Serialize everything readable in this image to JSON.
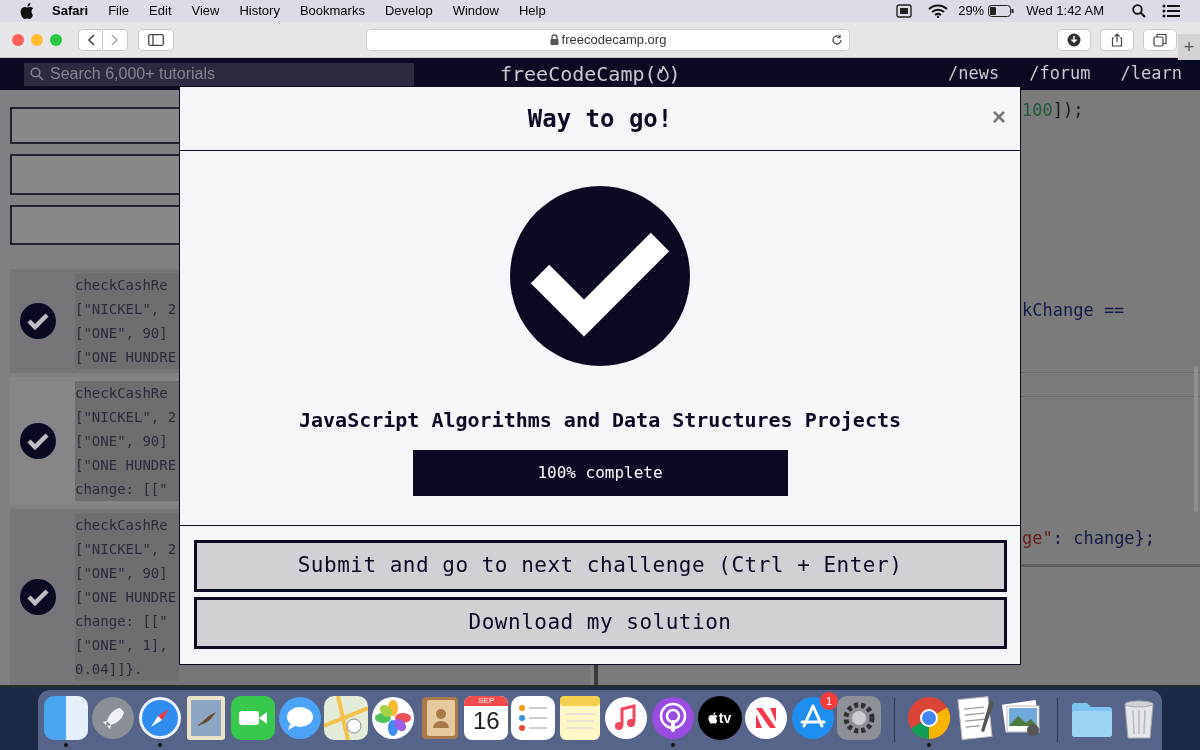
{
  "menu_bar": {
    "app_name": "Safari",
    "menus": [
      "File",
      "Edit",
      "View",
      "History",
      "Bookmarks",
      "Develop",
      "Window",
      "Help"
    ],
    "battery": "29%",
    "clock": "Wed 1:42 AM"
  },
  "browser": {
    "url": "freecodecamp.org",
    "new_tab": "+"
  },
  "site_nav": {
    "search_placeholder": "Search 6,000+ tutorials",
    "logo": "freeCodeCamp",
    "logo_open": "(",
    "logo_close": ")",
    "links": [
      "/news",
      "/forum",
      "/learn"
    ]
  },
  "tests": [
    {
      "passed": true,
      "lines": [
        "checkCashRe",
        "[\"NICKEL\", 2",
        "[\"ONE\", 90]",
        "[\"ONE HUNDRE"
      ]
    },
    {
      "passed": true,
      "lines": [
        "checkCashRe",
        "[\"NICKEL\", 2",
        "[\"ONE\", 90]",
        "[\"ONE HUNDRE",
        "change: [[\""
      ]
    },
    {
      "passed": true,
      "lines": [
        "checkCashRe",
        "[\"NICKEL\", 2",
        "[\"ONE\", 90]",
        "[\"ONE HUNDRE",
        "change: [[\"",
        "[\"ONE\", 1],",
        "0.04]]}."
      ]
    }
  ],
  "editor": {
    "lines": [
      {
        "parts": [
          {
            "text": "100",
            "kind": "number"
          },
          {
            "text": "]);",
            "kind": "plain"
          }
        ]
      },
      {
        "parts": [
          {
            "text": "kChange ==",
            "kind": "variable"
          }
        ]
      },
      {
        "parts": [
          {
            "text": "ge\"",
            "kind": "string"
          },
          {
            "text": ": change};",
            "kind": "variable"
          }
        ]
      }
    ]
  },
  "modal": {
    "title": "Way to go!",
    "close": "×",
    "block": "JavaScript Algorithms and Data Structures Projects",
    "progress": {
      "level": 1,
      "label": "100% complete"
    },
    "buttons": [
      "Submit and go to next challenge (Ctrl + Enter)",
      "Download my solution"
    ]
  },
  "dock": {
    "apps": [
      {
        "kind": "finder",
        "running": true
      },
      {
        "kind": "launchpad",
        "running": false
      },
      {
        "kind": "safari",
        "running": true
      },
      {
        "kind": "mail",
        "running": false
      },
      {
        "kind": "facetime",
        "running": false
      },
      {
        "kind": "messages",
        "running": false
      },
      {
        "kind": "maps",
        "running": false
      },
      {
        "kind": "photos",
        "running": false
      },
      {
        "kind": "contacts",
        "running": false
      },
      {
        "kind": "calendar",
        "running": false,
        "month": "SEP",
        "day": "16"
      },
      {
        "kind": "reminders",
        "running": false
      },
      {
        "kind": "notes",
        "running": false
      },
      {
        "kind": "music",
        "running": false
      },
      {
        "kind": "podcasts",
        "running": true
      },
      {
        "kind": "tv",
        "running": false,
        "label": "tv"
      },
      {
        "kind": "news",
        "running": false
      },
      {
        "kind": "appstore",
        "running": false,
        "badge": "1"
      },
      {
        "kind": "prefs",
        "running": false
      },
      {
        "kind": "separator"
      },
      {
        "kind": "chrome",
        "running": true
      },
      {
        "kind": "textedit",
        "running": false
      },
      {
        "kind": "preview",
        "running": false
      },
      {
        "kind": "separator"
      },
      {
        "kind": "folder",
        "running": false
      },
      {
        "kind": "trash",
        "running": false
      }
    ]
  }
}
